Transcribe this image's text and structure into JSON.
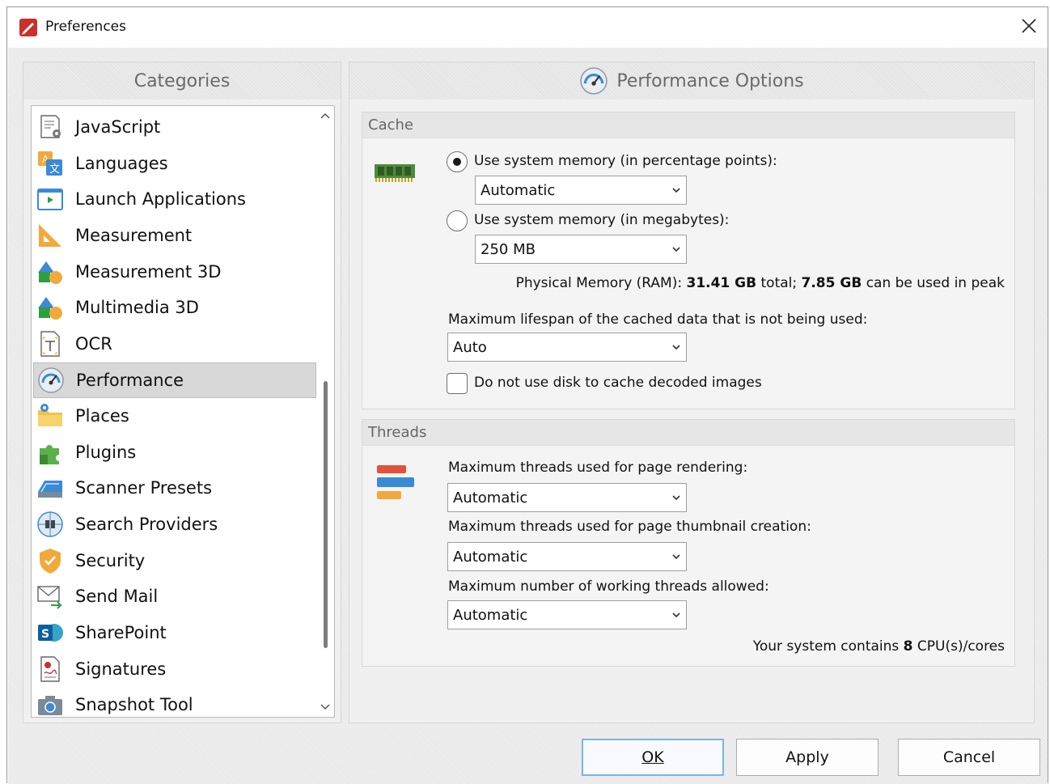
{
  "window": {
    "title": "Preferences"
  },
  "categories": {
    "header": "Categories",
    "items": [
      {
        "label": "JavaScript",
        "icon": "javascript-icon"
      },
      {
        "label": "Languages",
        "icon": "languages-icon"
      },
      {
        "label": "Launch Applications",
        "icon": "launch-applications-icon"
      },
      {
        "label": "Measurement",
        "icon": "measurement-icon"
      },
      {
        "label": "Measurement 3D",
        "icon": "measurement-3d-icon"
      },
      {
        "label": "Multimedia 3D",
        "icon": "multimedia-3d-icon"
      },
      {
        "label": "OCR",
        "icon": "ocr-icon"
      },
      {
        "label": "Performance",
        "icon": "performance-icon"
      },
      {
        "label": "Places",
        "icon": "places-icon"
      },
      {
        "label": "Plugins",
        "icon": "plugins-icon"
      },
      {
        "label": "Scanner Presets",
        "icon": "scanner-icon"
      },
      {
        "label": "Search Providers",
        "icon": "search-providers-icon"
      },
      {
        "label": "Security",
        "icon": "security-shield-icon"
      },
      {
        "label": "Send Mail",
        "icon": "send-mail-icon"
      },
      {
        "label": "SharePoint",
        "icon": "sharepoint-icon"
      },
      {
        "label": "Signatures",
        "icon": "signatures-icon"
      },
      {
        "label": "Snapshot Tool",
        "icon": "camera-icon"
      }
    ],
    "selected": "Performance"
  },
  "performance": {
    "header": "Performance Options",
    "cache": {
      "title": "Cache",
      "radio_percent_label": "Use system memory (in percentage points):",
      "radio_percent_checked": true,
      "percent_value": "Automatic",
      "radio_mb_label": "Use system memory (in megabytes):",
      "radio_mb_checked": false,
      "mb_value": "250 MB",
      "ram_prefix": "Physical Memory (RAM): ",
      "ram_total": "31.41 GB",
      "ram_mid": " total; ",
      "ram_peak": "7.85 GB",
      "ram_suffix": " can be used in peak",
      "lifespan_label": "Maximum lifespan of the cached data that is not being used:",
      "lifespan_value": "Auto",
      "disk_cache_label": "Do not use disk to cache decoded images",
      "disk_cache_checked": false
    },
    "threads": {
      "title": "Threads",
      "render_label": "Maximum threads used for page rendering:",
      "render_value": "Automatic",
      "thumb_label": "Maximum threads used for page thumbnail creation:",
      "thumb_value": "Automatic",
      "working_label": "Maximum number of working threads allowed:",
      "working_value": "Automatic",
      "cpu_prefix": "Your system contains ",
      "cpu_count": "8",
      "cpu_suffix": " CPU(s)/cores"
    }
  },
  "buttons": {
    "ok": "OK",
    "apply": "Apply",
    "cancel": "Cancel"
  },
  "colors": {
    "selection": "#d8d8d8",
    "default_button_border": "#7fb2e5"
  }
}
